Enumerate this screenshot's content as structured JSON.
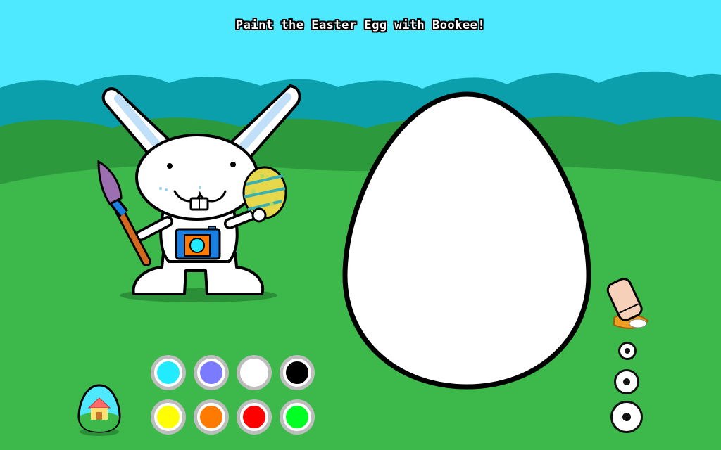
{
  "title": "Paint the Easter Egg with Bookee!",
  "colors": {
    "sky": "#4ee8ff",
    "hills_far": "#0b9fab",
    "hills_mid": "#2c9a3c",
    "grass": "#3db84a"
  },
  "palette": [
    {
      "name": "cyan",
      "color": "#22eaff"
    },
    {
      "name": "periwinkle",
      "color": "#7b7bff"
    },
    {
      "name": "white",
      "color": "#ffffff"
    },
    {
      "name": "black",
      "color": "#000000"
    },
    {
      "name": "yellow",
      "color": "#ffff00"
    },
    {
      "name": "orange",
      "color": "#ff7a00"
    },
    {
      "name": "red",
      "color": "#ff0000"
    },
    {
      "name": "green",
      "color": "#00ff22"
    }
  ],
  "brush_sizes": [
    "small",
    "medium",
    "large"
  ],
  "icons": {
    "home": "home-egg-icon",
    "eraser": "eraser-icon"
  }
}
